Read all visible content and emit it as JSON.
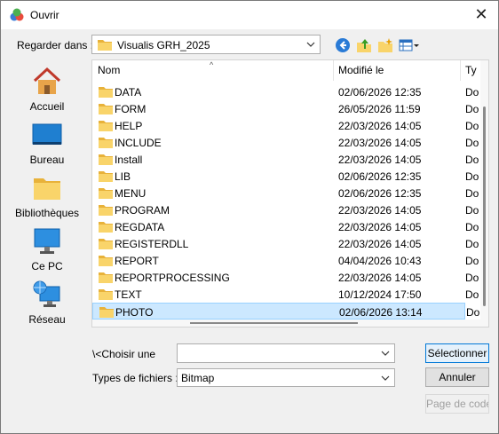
{
  "window": {
    "title": "Ouvrir"
  },
  "lookin": {
    "label": "Regarder dans :",
    "value": "Visualis GRH_2025"
  },
  "places": [
    {
      "label": "Accueil"
    },
    {
      "label": "Bureau"
    },
    {
      "label": "Bibliothèques"
    },
    {
      "label": "Ce PC"
    },
    {
      "label": "Réseau"
    }
  ],
  "columns": {
    "name": "Nom",
    "modified": "Modifié le",
    "type": "Ty"
  },
  "files": [
    {
      "name": "DATA",
      "modified": "02/06/2026 12:35",
      "type": "Do"
    },
    {
      "name": "FORM",
      "modified": "26/05/2026 11:59",
      "type": "Do"
    },
    {
      "name": "HELP",
      "modified": "22/03/2026 14:05",
      "type": "Do"
    },
    {
      "name": "INCLUDE",
      "modified": "22/03/2026 14:05",
      "type": "Do"
    },
    {
      "name": "Install",
      "modified": "22/03/2026 14:05",
      "type": "Do"
    },
    {
      "name": "LIB",
      "modified": "02/06/2026 12:35",
      "type": "Do"
    },
    {
      "name": "MENU",
      "modified": "02/06/2026 12:35",
      "type": "Do"
    },
    {
      "name": "PROGRAM",
      "modified": "22/03/2026 14:05",
      "type": "Do"
    },
    {
      "name": "REGDATA",
      "modified": "22/03/2026 14:05",
      "type": "Do"
    },
    {
      "name": "REGISTERDLL",
      "modified": "22/03/2026 14:05",
      "type": "Do"
    },
    {
      "name": "REPORT",
      "modified": "04/04/2026 10:43",
      "type": "Do"
    },
    {
      "name": "REPORTPROCESSING",
      "modified": "22/03/2026 14:05",
      "type": "Do"
    },
    {
      "name": "TEXT",
      "modified": "10/12/2024 17:50",
      "type": "Do"
    },
    {
      "name": "PHOTO",
      "modified": "02/06/2026 13:14",
      "type": "Do",
      "selected": true
    }
  ],
  "filename": {
    "label": "\\<Choisir une",
    "value": ""
  },
  "filetype": {
    "label": "Types de fichiers :",
    "value": "Bitmap"
  },
  "buttons": {
    "select": "Sélectionner",
    "cancel": "Annuler",
    "page": "Page de code..."
  },
  "colors": {
    "folder": "#f9d46a",
    "folder_dark": "#e8b23a",
    "selection": "#cce8ff",
    "accent": "#0078d7"
  }
}
